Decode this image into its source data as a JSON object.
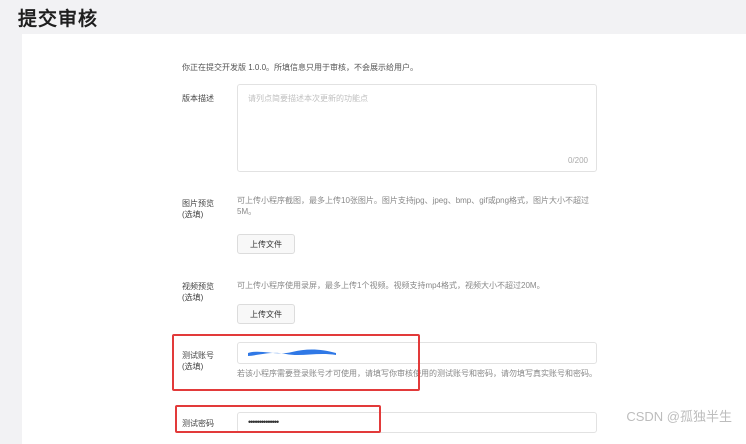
{
  "page": {
    "title": "提交审核"
  },
  "form": {
    "intro": "你正在提交开发版 1.0.0。所填信息只用于审核，不会展示给用户。",
    "version_desc": {
      "label": "版本描述",
      "placeholder": "请列点简要描述本次更新的功能点",
      "counter": "0/200"
    },
    "image_preview": {
      "label": "图片预览",
      "optional": "(选填)",
      "hint": "可上传小程序截图，最多上传10张图片。图片支持jpg、jpeg、bmp、gif或png格式，图片大小不超过5M。",
      "button": "上传文件"
    },
    "video_preview": {
      "label": "视频预览",
      "optional": "(选填)",
      "hint": "可上传小程序使用录屏，最多上传1个视频。视频支持mp4格式，视频大小不超过20M。",
      "button": "上传文件"
    },
    "test_account": {
      "label": "测试账号",
      "optional": "(选填)",
      "value_redacted": true,
      "hint": "若该小程序需要登录账号才可使用，请填写你审核使用的测试账号和密码，请勿填写真实账号和密码。"
    },
    "test_password": {
      "label": "测试密码",
      "value": "••••••••••••••"
    }
  },
  "annotations": {
    "highlight_color": "#e23a3a",
    "redaction_color": "#2f78e6"
  },
  "watermark": "CSDN @孤独半生"
}
